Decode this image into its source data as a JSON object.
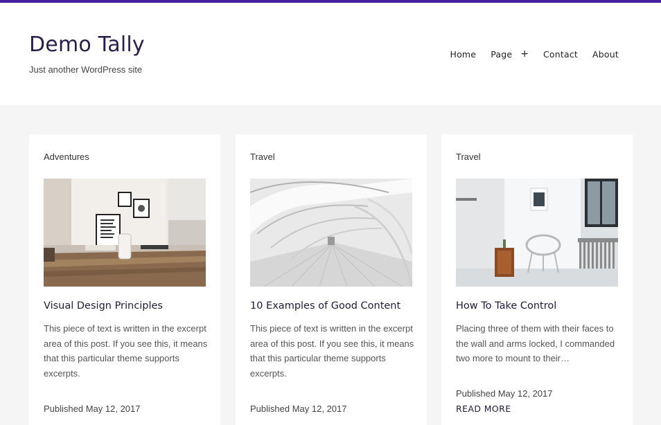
{
  "site": {
    "title": "Demo Tally",
    "description": "Just another WordPress site",
    "accent_color": "#4a1ea0"
  },
  "nav": {
    "items": [
      {
        "label": "Home"
      },
      {
        "label": "Page",
        "submenu_toggle": "+"
      },
      {
        "label": "Contact"
      },
      {
        "label": "About"
      }
    ]
  },
  "posts": [
    {
      "category": "Adventures",
      "image": "dining-room-photo",
      "title": "Visual Design Principles",
      "excerpt": "This piece of text is written in the excerpt area of this post. If you see this, it means that this particular theme supports excerpts.",
      "published": "Published May 12, 2017"
    },
    {
      "category": "Travel",
      "image": "white-arches-corridor-photo",
      "title": "10 Examples of Good Content",
      "excerpt": "This piece of text is written in the excerpt area of this post. If you see this, it means that this particular theme supports excerpts.",
      "published": "Published May 12, 2017"
    },
    {
      "category": "Travel",
      "image": "white-room-chair-photo",
      "title": "How To Take Control",
      "excerpt": "Placing three of them with their faces to the wall and arms locked, I commanded two more to mount to their…",
      "published": "Published May 12, 2017",
      "read_more": "READ MORE"
    }
  ]
}
